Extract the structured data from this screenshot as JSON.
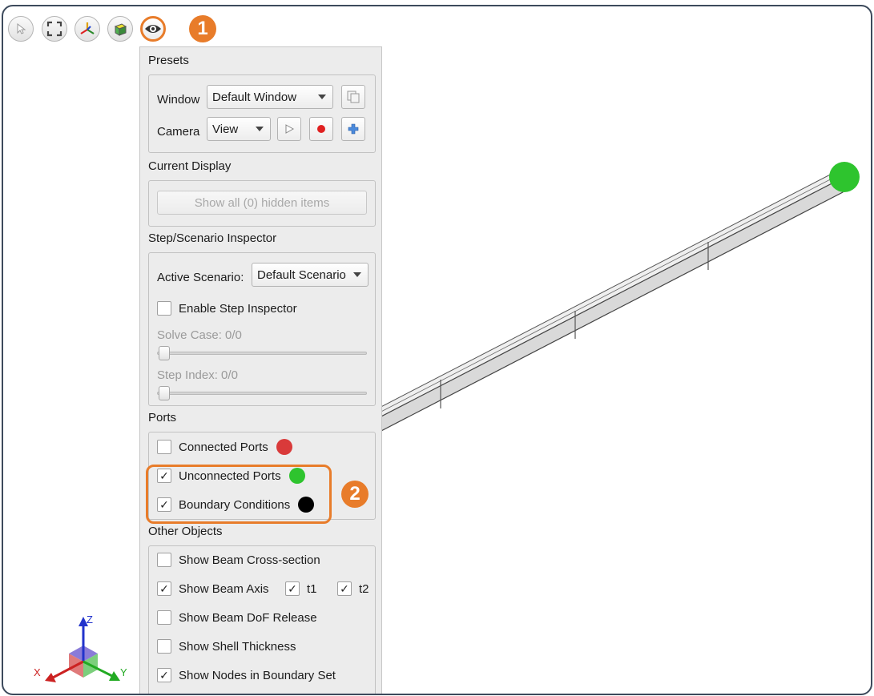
{
  "toolbar": {
    "buttons": [
      {
        "icon": "select-pointer-icon"
      },
      {
        "icon": "fit-view-icon"
      },
      {
        "icon": "axes-triad-icon"
      },
      {
        "icon": "iso-cube-icon"
      },
      {
        "icon": "eye-icon"
      }
    ],
    "callout_1": "1",
    "callout_2": "2"
  },
  "presets": {
    "title": "Presets",
    "window_label": "Window",
    "window_value": "Default Window",
    "camera_label": "Camera",
    "camera_value": "View"
  },
  "current_display": {
    "title": "Current Display",
    "show_hidden_button": "Show all (0) hidden items"
  },
  "step_inspector": {
    "title": "Step/Scenario Inspector",
    "active_scenario_label": "Active Scenario:",
    "active_scenario_value": "Default Scenario",
    "enable_label": "Enable Step Inspector",
    "solve_case_label": "Solve Case: 0/0",
    "step_index_label": "Step Index: 0/0",
    "solve_case_level": 0,
    "step_index_level": 0
  },
  "ports": {
    "title": "Ports",
    "items": [
      {
        "label": "Connected Ports",
        "checked": false,
        "color": "#d93a3a"
      },
      {
        "label": "Unconnected Ports",
        "checked": true,
        "color": "#2ec42e"
      },
      {
        "label": "Boundary Conditions",
        "checked": true,
        "color": "#000000"
      }
    ]
  },
  "other_objects": {
    "title": "Other Objects",
    "cross_section": {
      "label": "Show Beam Cross-section",
      "checked": false
    },
    "beam_axis": {
      "label": "Show Beam Axis",
      "checked": true
    },
    "t1": {
      "label": "t1",
      "checked": true
    },
    "t2": {
      "label": "t2",
      "checked": true
    },
    "dof_release": {
      "label": "Show Beam DoF Release",
      "checked": false
    },
    "shell_thickness": {
      "label": "Show Shell Thickness",
      "checked": false
    },
    "nodes_boundary": {
      "label": "Show Nodes in Boundary Set",
      "checked": true
    }
  },
  "axes_gizmo": {
    "x": "X",
    "y": "Y",
    "z": "Z"
  },
  "colors": {
    "accent": "#e87c2a",
    "port_connected": "#d93a3a",
    "port_unconnected": "#2ec42e"
  },
  "check_mark": "✓"
}
